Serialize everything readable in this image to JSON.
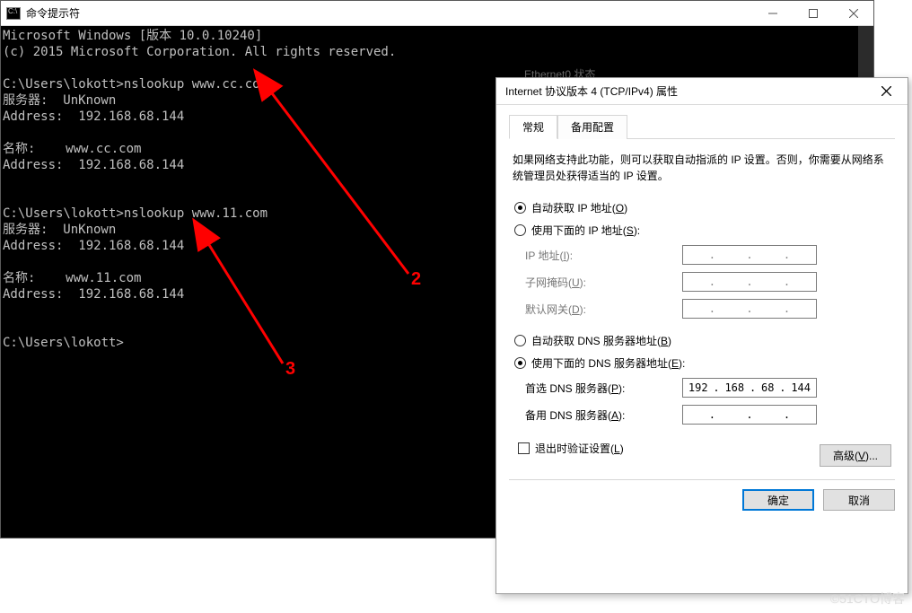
{
  "cmd": {
    "title": "命令提示符",
    "lines": [
      "Microsoft Windows [版本 10.0.10240]",
      "(c) 2015 Microsoft Corporation. All rights reserved.",
      "",
      "C:\\Users\\lokott>nslookup www.cc.com",
      "服务器:  UnKnown",
      "Address:  192.168.68.144",
      "",
      "名称:    www.cc.com",
      "Address:  192.168.68.144",
      "",
      "",
      "C:\\Users\\lokott>nslookup www.11.com",
      "服务器:  UnKnown",
      "Address:  192.168.68.144",
      "",
      "名称:    www.11.com",
      "Address:  192.168.68.144",
      "",
      "",
      "C:\\Users\\lokott>"
    ]
  },
  "background": {
    "ethernet_title": "Ethernet0 状态"
  },
  "dialog": {
    "title": "Internet 协议版本 4 (TCP/IPv4) 属性",
    "tabs": {
      "general": "常规",
      "alternate": "备用配置"
    },
    "infotext": "如果网络支持此功能，则可以获取自动指派的 IP 设置。否则，你需要从网络系统管理员处获得适当的 IP 设置。",
    "ip_section": {
      "auto_label_pre": "自动获取 IP 地址(",
      "auto_label_u": "O",
      "auto_label_post": ")",
      "manual_label_pre": "使用下面的 IP 地址(",
      "manual_label_u": "S",
      "manual_label_post": "):",
      "fields": {
        "ip_pre": "IP 地址(",
        "ip_u": "I",
        "ip_post": "):",
        "mask_pre": "子网掩码(",
        "mask_u": "U",
        "mask_post": "):",
        "gw_pre": "默认网关(",
        "gw_u": "D",
        "gw_post": "):"
      }
    },
    "dns_section": {
      "auto_label_pre": "自动获取 DNS 服务器地址(",
      "auto_label_u": "B",
      "auto_label_post": ")",
      "manual_label_pre": "使用下面的 DNS 服务器地址(",
      "manual_label_u": "E",
      "manual_label_post": "):",
      "fields": {
        "pref_pre": "首选 DNS 服务器(",
        "pref_u": "P",
        "pref_post": "):",
        "alt_pre": "备用 DNS 服务器(",
        "alt_u": "A",
        "alt_post": "):"
      },
      "preferred_value": {
        "a": "192",
        "b": "168",
        "c": "68",
        "d": "144"
      },
      "alternate_value": {
        "a": "",
        "b": "",
        "c": "",
        "d": ""
      }
    },
    "validate_checkbox_pre": "退出时验证设置(",
    "validate_checkbox_u": "L",
    "validate_checkbox_post": ")",
    "advanced_btn_pre": "高级(",
    "advanced_btn_u": "V",
    "advanced_btn_post": ")...",
    "ok": "确定",
    "cancel": "取消"
  },
  "annotations": {
    "label2": "2",
    "label3": "3"
  },
  "watermark": "©51CTO博客"
}
